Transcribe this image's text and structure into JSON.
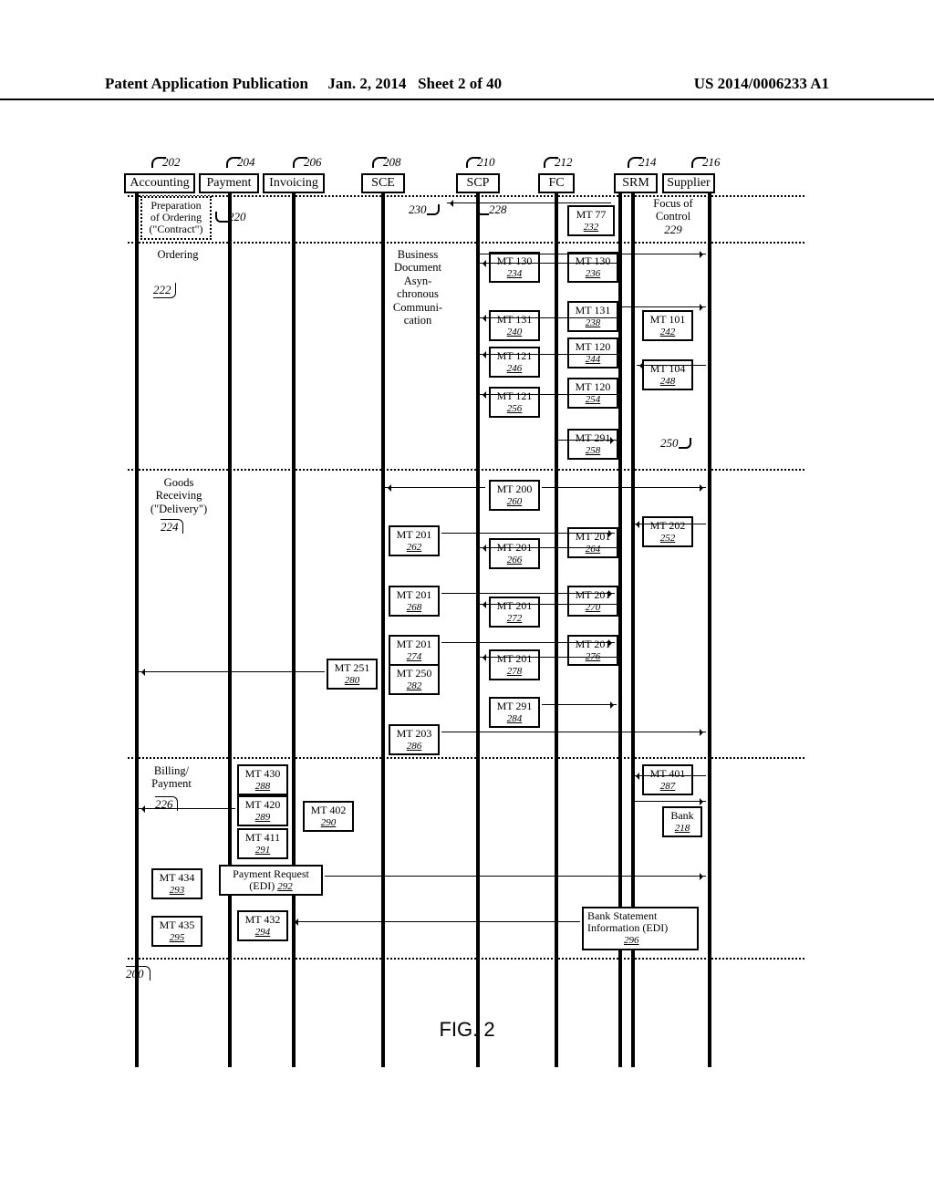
{
  "header": {
    "left": "Patent Application Publication",
    "center_date": "Jan. 2, 2014",
    "center_sheet": "Sheet 2 of 40",
    "right": "US 2014/0006233 A1"
  },
  "figure_label": "FIG. 2",
  "diagram_ref": "200",
  "lanes": [
    {
      "ref": "202",
      "label": "Accounting"
    },
    {
      "ref": "204",
      "label": "Payment"
    },
    {
      "ref": "206",
      "label": "Invoicing"
    },
    {
      "ref": "208",
      "label": "SCE"
    },
    {
      "ref": "210",
      "label": "SCP"
    },
    {
      "ref": "212",
      "label": "FC"
    },
    {
      "ref": "214",
      "label": "SRM"
    },
    {
      "ref": "216",
      "label": "Supplier"
    }
  ],
  "phases": [
    {
      "ref": "220",
      "label": "Preparation of Ordering (\"Contract\")"
    },
    {
      "ref": "222",
      "label": "Ordering"
    },
    {
      "ref": "224",
      "label": "Goods Receiving (\"Delivery\")"
    },
    {
      "ref": "226",
      "label": "Billing/ Payment"
    }
  ],
  "annotations": {
    "bdac": "Business Document Asyn- chronous Communi- cation",
    "focus": {
      "ref": "229",
      "label": "Focus of Control"
    },
    "arrow230": "230",
    "arrow228": "228",
    "right250": "250",
    "bank": {
      "ref": "218",
      "label": "Bank"
    },
    "pay_req": {
      "ref": "292",
      "label": "Payment Request (EDI)"
    },
    "bank_stmt": {
      "ref": "296",
      "label": "Bank Statement Information (EDI)"
    }
  },
  "mt": {
    "232": {
      "t": "MT 77",
      "r": "232"
    },
    "234": {
      "t": "MT 130",
      "r": "234"
    },
    "236": {
      "t": "MT 130",
      "r": "236"
    },
    "238": {
      "t": "MT 131",
      "r": "238"
    },
    "240": {
      "t": "MT 131",
      "r": "240"
    },
    "242": {
      "t": "MT 101",
      "r": "242"
    },
    "244": {
      "t": "MT 120",
      "r": "244"
    },
    "246": {
      "t": "MT 121",
      "r": "246"
    },
    "248": {
      "t": "MT 104",
      "r": "248"
    },
    "254": {
      "t": "MT 120",
      "r": "254"
    },
    "256": {
      "t": "MT 121",
      "r": "256"
    },
    "258": {
      "t": "MT 291",
      "r": "258"
    },
    "260": {
      "t": "MT 200",
      "r": "260"
    },
    "262": {
      "t": "MT 201",
      "r": "262"
    },
    "264": {
      "t": "MT 201",
      "r": "264"
    },
    "266": {
      "t": "MT 201",
      "r": "266"
    },
    "268": {
      "t": "MT 201",
      "r": "268"
    },
    "270": {
      "t": "MT 201",
      "r": "270"
    },
    "272": {
      "t": "MT 201",
      "r": "272"
    },
    "274": {
      "t": "MT 201",
      "r": "274"
    },
    "276": {
      "t": "MT 201",
      "r": "276"
    },
    "278": {
      "t": "MT 201",
      "r": "278"
    },
    "280": {
      "t": "MT 251",
      "r": "280"
    },
    "282": {
      "t": "MT 250",
      "r": "282"
    },
    "284": {
      "t": "MT 291",
      "r": "284"
    },
    "286": {
      "t": "MT 203",
      "r": "286"
    },
    "252": {
      "t": "MT 202",
      "r": "252"
    },
    "287": {
      "t": "MT 401",
      "r": "287"
    },
    "288": {
      "t": "MT 430",
      "r": "288"
    },
    "289": {
      "t": "MT 420",
      "r": "289"
    },
    "290": {
      "t": "MT 402",
      "r": "290"
    },
    "291": {
      "t": "MT 411",
      "r": "291"
    },
    "293": {
      "t": "MT 434",
      "r": "293"
    },
    "294": {
      "t": "MT 432",
      "r": "294"
    },
    "295": {
      "t": "MT 435",
      "r": "295"
    }
  }
}
